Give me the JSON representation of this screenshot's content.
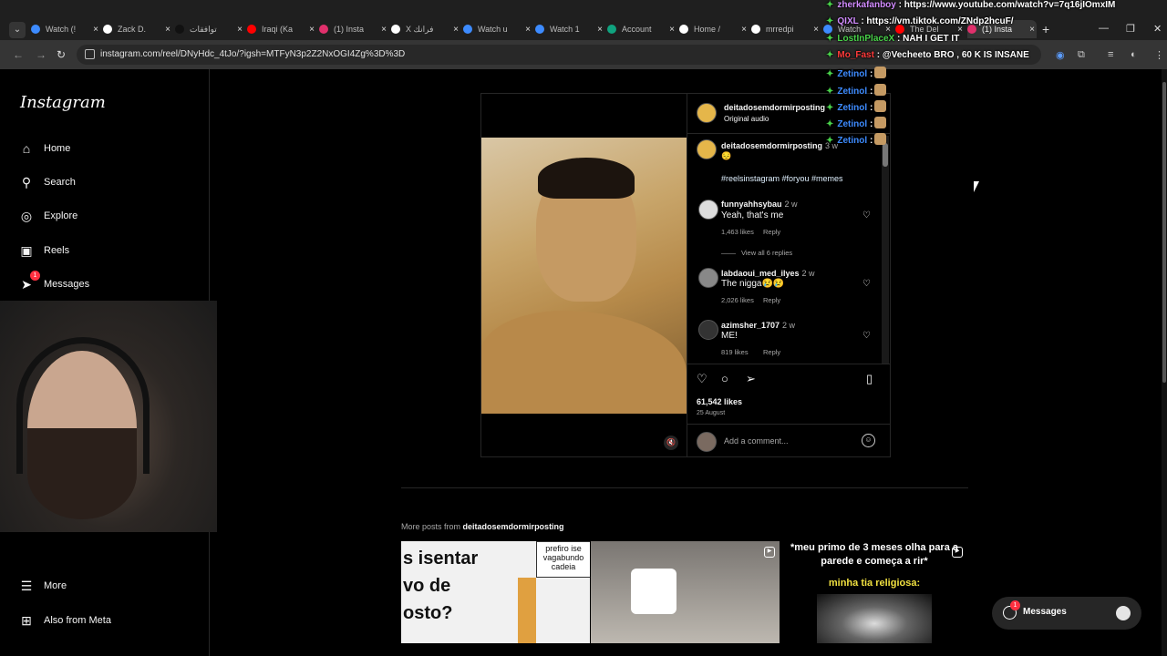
{
  "browser": {
    "tabs": [
      {
        "title": "Watch (!",
        "favicon_color": "#3d8bff"
      },
      {
        "title": "Zack D.",
        "favicon_color": "#ffffff"
      },
      {
        "title": "توافقات",
        "favicon_color": "#111111"
      },
      {
        "title": "Iraqi (Ka",
        "favicon_color": "#ff0000"
      },
      {
        "title": "(1) Insta",
        "favicon_color": "#e1306c"
      },
      {
        "title": "X فرانك",
        "favicon_color": "#ffffff"
      },
      {
        "title": "Watch u",
        "favicon_color": "#3d8bff"
      },
      {
        "title": "Watch 1",
        "favicon_color": "#3d8bff"
      },
      {
        "title": "Account",
        "favicon_color": "#10a37f"
      },
      {
        "title": "Home /",
        "favicon_color": "#ffffff"
      },
      {
        "title": "mrredpi",
        "favicon_color": "#ffffff"
      },
      {
        "title": "Watch",
        "favicon_color": "#3d8bff"
      },
      {
        "title": "The Del",
        "favicon_color": "#ff0000"
      },
      {
        "title": "(1) Insta",
        "favicon_color": "#e1306c"
      }
    ],
    "url": "instagram.com/reel/DNyHdc_4tJo/?igsh=MTFyN3p2Z2NxOGI4Zg%3D%3D"
  },
  "chat": [
    {
      "user": "zherkafanboy",
      "color": "#d28cff",
      "message": ": https://www.youtube.com/watch?v=7q16jIOmxIM",
      "emote": false
    },
    {
      "user": "QIXL",
      "color": "#d28cff",
      "message": ": https://vm.tiktok.com/ZNdp2hcuF/",
      "emote": false
    },
    {
      "user": "LostInPlaceX",
      "color": "#49d14a",
      "message": ": NAH I GET IT",
      "emote": false
    },
    {
      "user": "Mo_Fast",
      "color": "#ff3b3b",
      "message": ": @Vecheeto BRO , 60 K IS INSANE",
      "emote": false
    },
    {
      "user": "Zetinol",
      "color": "#3d8bff",
      "message": ":",
      "emote": true
    },
    {
      "user": "Zetinol",
      "color": "#3d8bff",
      "message": ":",
      "emote": true
    },
    {
      "user": "Zetinol",
      "color": "#3d8bff",
      "message": ":",
      "emote": true
    },
    {
      "user": "Zetinol",
      "color": "#3d8bff",
      "message": ":",
      "emote": true
    },
    {
      "user": "Zetinol",
      "color": "#3d8bff",
      "message": ":",
      "emote": true
    }
  ],
  "sidebar": {
    "logo": "Instagram",
    "items": [
      {
        "label": "Home",
        "icon": "home-icon"
      },
      {
        "label": "Search",
        "icon": "search-icon"
      },
      {
        "label": "Explore",
        "icon": "compass-icon"
      },
      {
        "label": "Reels",
        "icon": "reels-icon"
      },
      {
        "label": "Messages",
        "icon": "messenger-icon",
        "badge": "1"
      }
    ],
    "more": "More",
    "meta": "Also from Meta"
  },
  "post": {
    "author": "deitadosemdormirposting",
    "audio": "Original audio",
    "caption_time": "3 w",
    "caption_emoji": "😔",
    "hashtags": "#reelsinstagram #foryou #memes",
    "comments": [
      {
        "user": "funnyahhsybau",
        "time": "2 w",
        "text": "Yeah, that's me",
        "likes": "1,463 likes",
        "reply": "Reply",
        "view_replies": "View all 6 replies"
      },
      {
        "user": "labdaoui_med_ilyes",
        "time": "2 w",
        "text": "The nigga😢😢",
        "likes": "2,026 likes",
        "reply": "Reply"
      },
      {
        "user": "azimsher_1707",
        "time": "2 w",
        "text": "ME!",
        "likes": "819 likes",
        "reply": "Reply"
      }
    ],
    "likes": "61,542 likes",
    "date": "25 August",
    "add_comment": "Add a comment..."
  },
  "more_posts": {
    "prefix": "More posts from",
    "author": "deitadosemdormirposting",
    "thumb1_text": "s isentar\nvo de\nosto?",
    "thumb1_bubble": "prefiro ise vagabundo cadeia",
    "thumb3_caption": "*meu primo de 3 meses olha para a parede e começa a rir*",
    "thumb3_caption2": "minha tia religiosa:"
  },
  "messages_pill": {
    "label": "Messages",
    "badge": "1"
  }
}
